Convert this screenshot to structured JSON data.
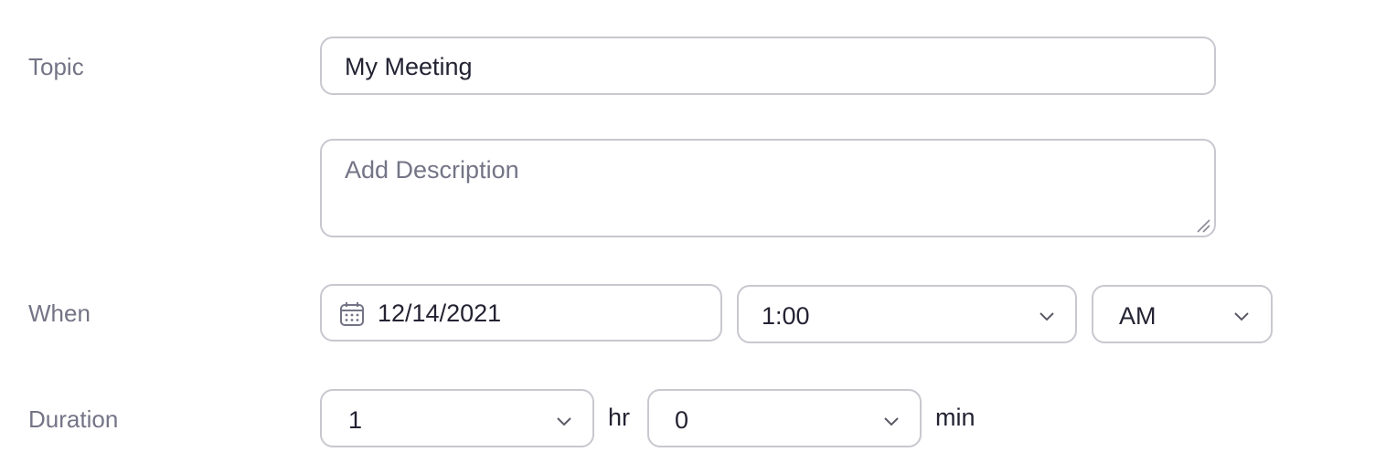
{
  "form": {
    "topic": {
      "label": "Topic",
      "value": "My Meeting"
    },
    "description": {
      "placeholder": "Add Description"
    },
    "when": {
      "label": "When",
      "date": "12/14/2021",
      "date_icon": "calendar-icon",
      "time": "1:00",
      "ampm": "AM"
    },
    "duration": {
      "label": "Duration",
      "hours": "1",
      "hours_unit": "hr",
      "minutes": "0",
      "minutes_unit": "min"
    }
  },
  "colors": {
    "label_text": "#747487",
    "value_text": "#232333",
    "border": "#c8c8d0"
  }
}
